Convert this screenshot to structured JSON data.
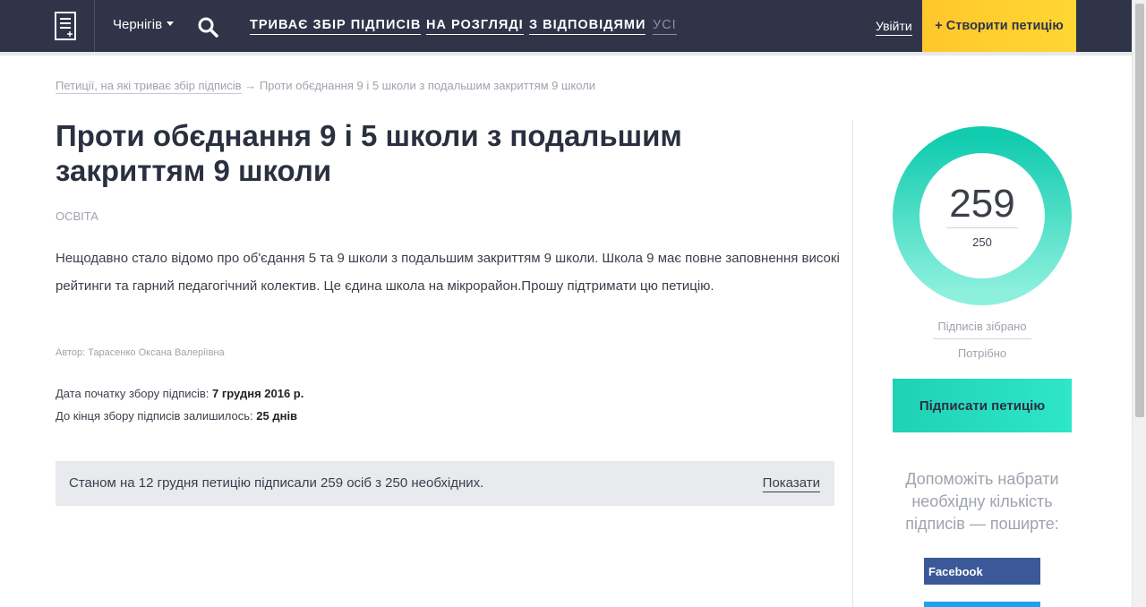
{
  "header": {
    "city": "Чернігів",
    "nav": [
      {
        "label": "ТРИВАЄ ЗБІР ПІДПИСІВ",
        "active": true
      },
      {
        "label": "НА РОЗГЛЯДІ",
        "active": true
      },
      {
        "label": "З ВІДПОВІДЯМИ",
        "active": true
      },
      {
        "label": "УСІ",
        "active": false
      }
    ],
    "login": "Увійти",
    "create": "+ Створити петицію"
  },
  "breadcrumb": {
    "parent": "Петиції, на які триває збір підписів",
    "arrow": "→",
    "current": "Проти обєднання 9 і 5 школи з подальшим закриттям 9 школи"
  },
  "petition": {
    "title": "Проти обєднання 9 і 5 школи з подальшим закриттям 9 школи",
    "category": "ОСВІТА",
    "description": "Нещодавно стало відомо про об'єдання 5 та 9 школи з подальшим закриттям 9 школи. Школа 9 має повне заповнення високі рейтинги та гарний педагогічний колектив. Це єдина школа на мікрорайон.Прошу підтримати цю петицію.",
    "author_label": "Автор:",
    "author": "Тарасенко Оксана Валеріївна",
    "start_label": "Дата початку збору підписів:",
    "start_date": "7 грудня 2016 р.",
    "remaining_label": "До кінця збору підписів залишилось:",
    "remaining": "25 днів"
  },
  "status": {
    "text": "Станом на 12 грудня петицію підписали 259 осіб з 250 необхідних.",
    "show": "Показати"
  },
  "sidebar": {
    "collected": "259",
    "needed": "250",
    "progress": 1.0,
    "collected_label": "Підписів зібрано",
    "needed_label": "Потрібно",
    "sign": "Підписати петицію",
    "help": "Допоможіть набрати необхідну кількість підписів — поширте:",
    "facebook": "Facebook"
  },
  "colors": {
    "header_bg": "#2f3448",
    "accent_yellow": "#ffc72c",
    "accent_teal": "#1fd1b5",
    "facebook": "#3b5998"
  }
}
